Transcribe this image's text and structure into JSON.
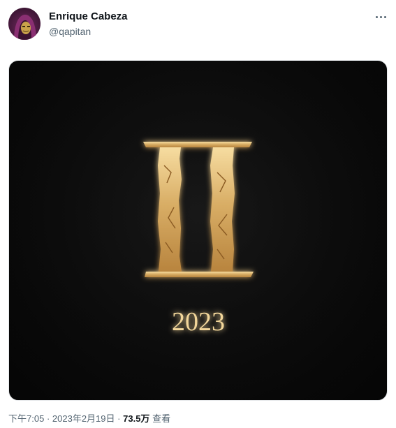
{
  "author": {
    "name": "Enrique Cabeza",
    "handle": "@qapitan"
  },
  "media": {
    "numeral": "II",
    "year": "2023",
    "numeral_color": "#e9c98a",
    "glow_color": "#ffcf7a",
    "background_color": "#0b0b0b"
  },
  "meta": {
    "time": "下午7:05",
    "separator": "·",
    "date": "2023年2月19日",
    "views_count": "73.5万",
    "views_label": "查看"
  },
  "icons": {
    "more": "more-horizontal-icon"
  }
}
